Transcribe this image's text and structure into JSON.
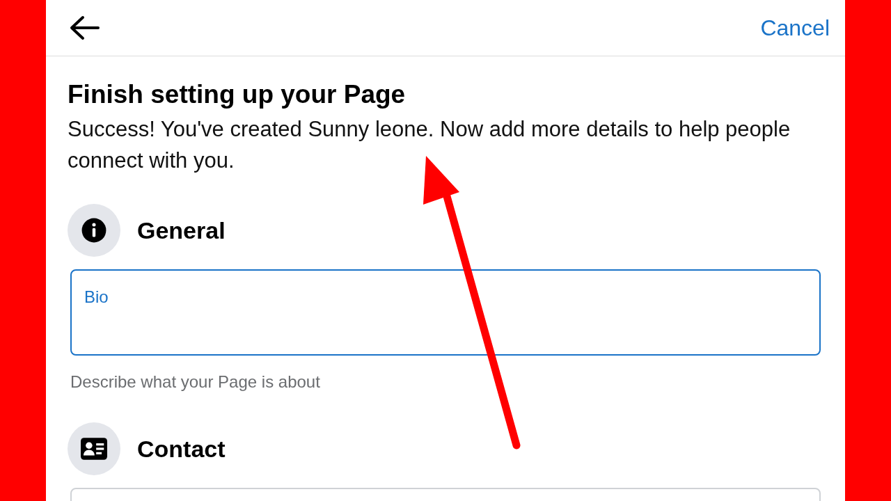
{
  "header": {
    "cancel": "Cancel"
  },
  "title": "Finish setting up your Page",
  "message": "Success! You've created Sunny leone. Now add more details to help people connect with you.",
  "sections": [
    {
      "kind": "info",
      "title": "General",
      "field": {
        "label": "Bio",
        "focused": true,
        "helper": "Describe what your Page is about"
      }
    },
    {
      "kind": "contact",
      "title": "Contact",
      "field": {
        "focused": false
      }
    }
  ]
}
